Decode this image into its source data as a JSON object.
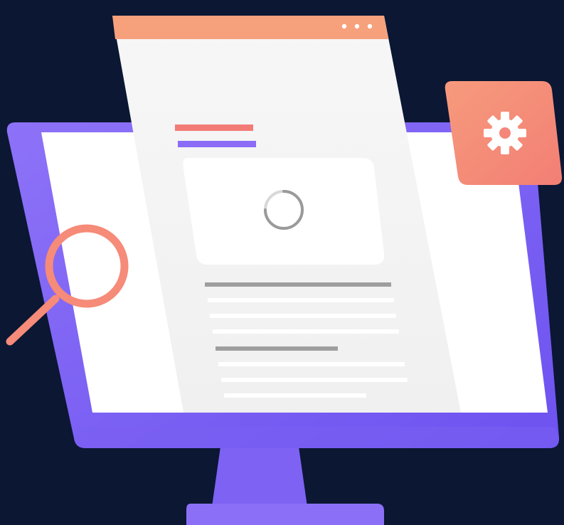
{
  "illustration": {
    "background_color": "#0b1733",
    "monitor": {
      "frame_color": "#8a6cf7",
      "frame_shadow_color": "#6f55ee",
      "screen_color": "#ffffff",
      "stand_color": "#8a6cf7"
    },
    "document_window": {
      "titlebar_color": "#f7a07c",
      "body_color": "#f4f4f4",
      "titlebar_dots": 3,
      "heading_bar_colors": [
        "#f37b76",
        "#8a6cf7"
      ],
      "media_placeholder_icon": "loading-spinner-icon"
    },
    "settings_badge": {
      "color": "#f58b78",
      "icon": "gear-icon"
    },
    "magnifier": {
      "color": "#f58b78",
      "icon": "magnifying-glass-icon"
    }
  }
}
